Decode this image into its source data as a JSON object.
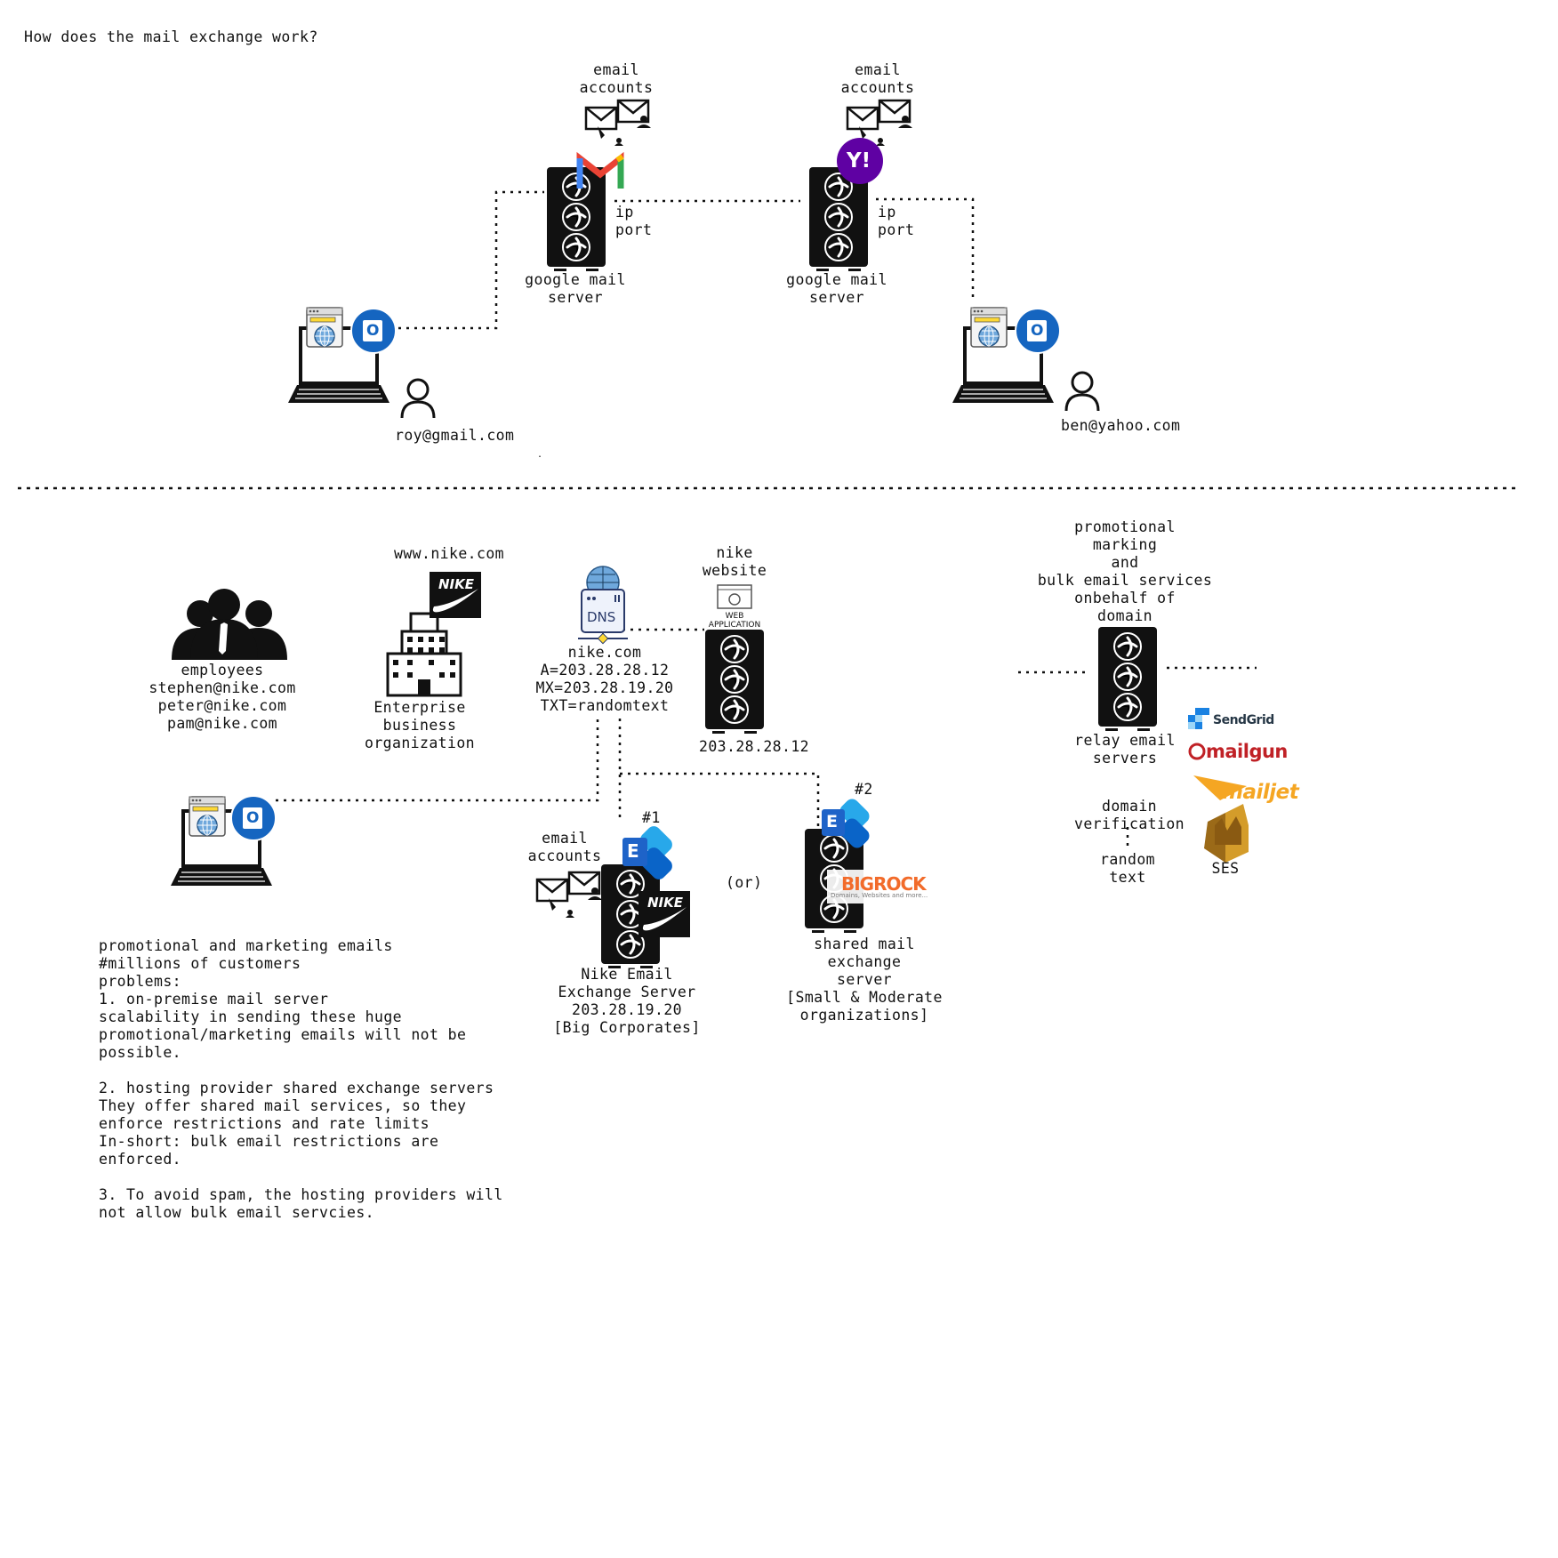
{
  "title": "How does the mail exchange work?",
  "top": {
    "gmail_accounts_label": "email\naccounts",
    "yahoo_accounts_label": "email\naccounts",
    "gmail_ipport_label": "ip\nport",
    "yahoo_ipport_label": "ip\nport",
    "gmail_server_label": "google mail\nserver",
    "yahoo_server_label": "google mail\nserver",
    "roy_email": "roy@gmail.com",
    "ben_email": "ben@yahoo.com",
    "stray_dot": "."
  },
  "bottom": {
    "employees_label": "employees\nstephen@nike.com\npeter@nike.com\npam@nike.com",
    "www_label": "www.nike.com",
    "enterprise_label": "Enterprise\nbusiness\norganization",
    "dns_badge": "DNS",
    "dns_records": "nike.com\nA=203.28.28.12\nMX=203.28.19.20\nTXT=randomtext",
    "website_label": "nike\nwebsite",
    "web_app_label": "WEB\nAPPLICATION",
    "website_ip": "203.28.28.12",
    "promo_label": "promotional\nmarking\nand\nbulk email services\nonbehalf of\ndomain",
    "relay_label": "relay email\nservers",
    "domain_verification": "domain\nverification",
    "random_text": "random\ntext",
    "ses_label": "SES",
    "sendgrid_logo": "SendGrid",
    "mailgun_logo": "mailgun",
    "mailjet_logo": "mailjet",
    "nike_accounts_label": "email\naccounts",
    "num1": "#1",
    "num2": "#2",
    "or_label": "(or)",
    "nike_server_label": "Nike Email\nExchange Server\n203.28.19.20\n[Big Corporates]",
    "shared_server_label": "shared mail\nexchange\nserver\n[Small & Moderate\norganizations]",
    "bigrock_logo": "BIGROCK",
    "bigrock_tagline": "Domains, Websites and more...",
    "exchange_letter": "E",
    "outlook_letter": "O",
    "yahoo_logo": "Y!",
    "nike_logo": "NIKE",
    "problems_text": "promotional and marketing emails\n#millions of customers\nproblems:\n1. on-premise mail server\nscalability in sending these huge\npromotional/marketing emails will not be\npossible.\n\n2. hosting provider shared exchange servers\nThey offer shared mail services, so they\nenforce restrictions and rate limits\nIn-short: bulk email restrictions are\nenforced.\n\n3. To avoid spam, the hosting providers will\nnot allow bulk email servcies."
  },
  "colors": {
    "outlook_blue": "#1565c0",
    "exchange_blue": "#1e63c8",
    "yahoo_purple": "#5f01a3",
    "gmail_red": "#ea4335",
    "gmail_blue": "#4285f4",
    "gmail_green": "#34a853",
    "gmail_yellow": "#fbbc04",
    "mailjet_orange": "#f5a623",
    "sendgrid_blue": "#1a82e2",
    "mailgun_red": "#c02126",
    "ses_gold": "#d49c2a",
    "bigrock_orange": "#f26b2a",
    "line_dark": "#111111"
  }
}
